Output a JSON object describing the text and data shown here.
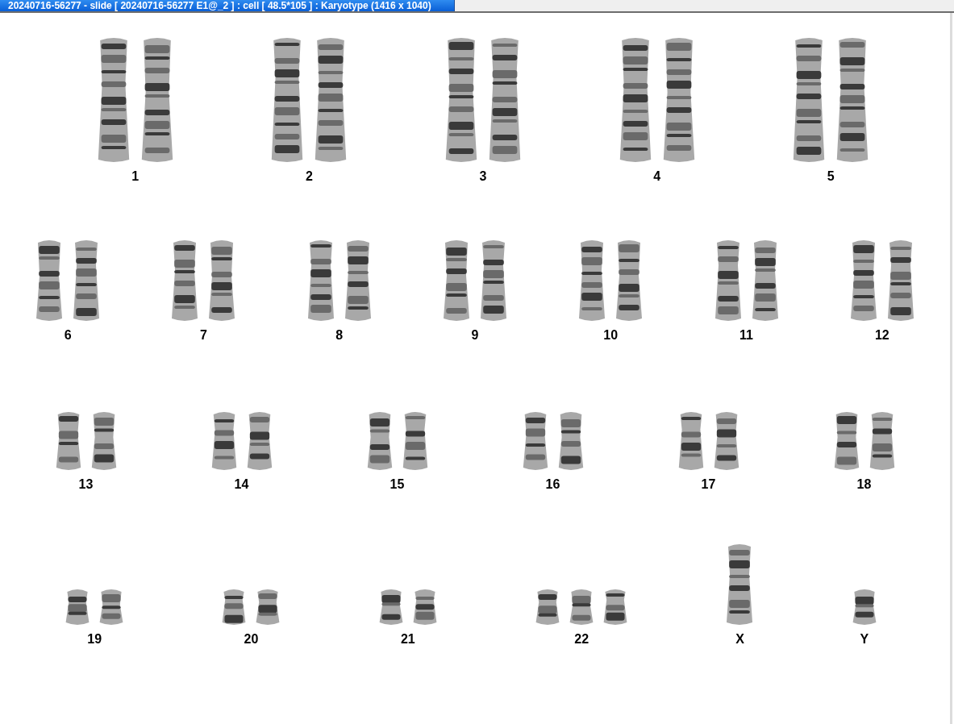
{
  "window": {
    "title": "20240716-56277 - slide [ 20240716-56277 E1@_2 ] : cell [ 48.5*105 ] : Karyotype  (1416 x 1040)"
  },
  "karyotype": {
    "rows": [
      {
        "groups": [
          {
            "label": "1",
            "chromosomes": [
              {
                "kind": "large"
              },
              {
                "kind": "large"
              }
            ]
          },
          {
            "label": "2",
            "chromosomes": [
              {
                "kind": "large"
              },
              {
                "kind": "large"
              }
            ]
          },
          {
            "label": "3",
            "chromosomes": [
              {
                "kind": "large"
              },
              {
                "kind": "large"
              }
            ]
          },
          {
            "label": "4",
            "chromosomes": [
              {
                "kind": "large"
              },
              {
                "kind": "large"
              }
            ]
          },
          {
            "label": "5",
            "chromosomes": [
              {
                "kind": "large"
              },
              {
                "kind": "large"
              }
            ]
          }
        ]
      },
      {
        "groups": [
          {
            "label": "6",
            "chromosomes": [
              {
                "kind": "medium"
              },
              {
                "kind": "medium"
              }
            ]
          },
          {
            "label": "7",
            "chromosomes": [
              {
                "kind": "medium"
              },
              {
                "kind": "medium"
              }
            ]
          },
          {
            "label": "8",
            "chromosomes": [
              {
                "kind": "medium"
              },
              {
                "kind": "medium"
              }
            ]
          },
          {
            "label": "9",
            "chromosomes": [
              {
                "kind": "medium"
              },
              {
                "kind": "medium"
              }
            ]
          },
          {
            "label": "10",
            "chromosomes": [
              {
                "kind": "medium"
              },
              {
                "kind": "medium"
              }
            ]
          },
          {
            "label": "11",
            "chromosomes": [
              {
                "kind": "medium"
              },
              {
                "kind": "medium"
              }
            ]
          },
          {
            "label": "12",
            "chromosomes": [
              {
                "kind": "medium"
              },
              {
                "kind": "medium"
              }
            ]
          }
        ]
      },
      {
        "groups": [
          {
            "label": "13",
            "chromosomes": [
              {
                "kind": "small"
              },
              {
                "kind": "small"
              }
            ]
          },
          {
            "label": "14",
            "chromosomes": [
              {
                "kind": "small"
              },
              {
                "kind": "small"
              }
            ]
          },
          {
            "label": "15",
            "chromosomes": [
              {
                "kind": "small"
              },
              {
                "kind": "small"
              }
            ]
          },
          {
            "label": "16",
            "chromosomes": [
              {
                "kind": "small"
              },
              {
                "kind": "small"
              }
            ]
          },
          {
            "label": "17",
            "chromosomes": [
              {
                "kind": "small"
              },
              {
                "kind": "small"
              }
            ]
          },
          {
            "label": "18",
            "chromosomes": [
              {
                "kind": "small"
              },
              {
                "kind": "small"
              }
            ]
          }
        ]
      },
      {
        "groups": [
          {
            "label": "19",
            "chromosomes": [
              {
                "kind": "tiny"
              },
              {
                "kind": "tiny"
              }
            ]
          },
          {
            "label": "20",
            "chromosomes": [
              {
                "kind": "tiny"
              },
              {
                "kind": "tiny"
              }
            ]
          },
          {
            "label": "21",
            "chromosomes": [
              {
                "kind": "tiny"
              },
              {
                "kind": "tiny"
              }
            ]
          },
          {
            "label": "22",
            "chromosomes": [
              {
                "kind": "tiny"
              },
              {
                "kind": "tiny"
              },
              {
                "kind": "tiny"
              }
            ]
          },
          {
            "label": "X",
            "chromosomes": [
              {
                "kind": "medium"
              }
            ]
          },
          {
            "label": "Y",
            "chromosomes": [
              {
                "kind": "tiny"
              }
            ]
          }
        ]
      }
    ]
  }
}
